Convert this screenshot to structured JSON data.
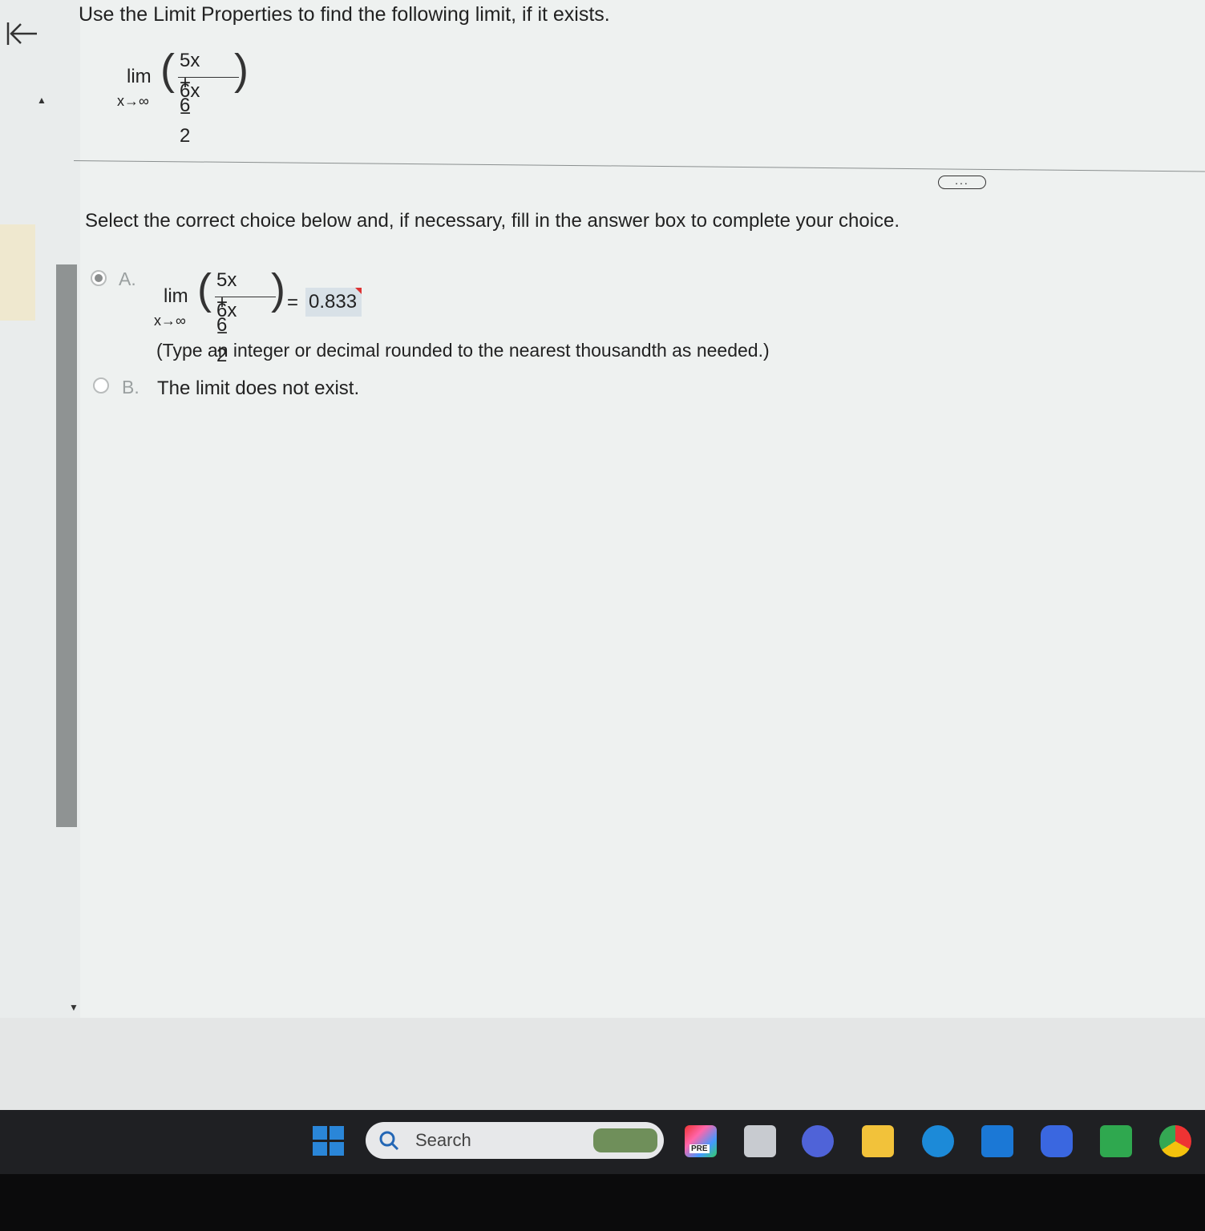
{
  "question": {
    "text": "Use the Limit Properties to find the following limit, if it exists.",
    "lim": "lim",
    "subscript": "x→∞",
    "numerator": "5x + 6",
    "denominator": "6x − 2"
  },
  "instruction": "Select the correct choice below and, if necessary, fill in the answer box to complete your choice.",
  "choice_a": {
    "letter": "A.",
    "lim": "lim",
    "subscript": "x→∞",
    "numerator": "5x + 6",
    "denominator": "6x − 2",
    "equals": "=",
    "answer": "0.833",
    "hint": "(Type an integer or decimal rounded to the nearest thousandth as needed.)",
    "selected": true
  },
  "choice_b": {
    "letter": "B.",
    "text": "The limit does not exist.",
    "selected": false
  },
  "more_button": "...",
  "taskbar": {
    "search_label": "Search",
    "pre_badge": "PRE",
    "icons": [
      "windows-start-icon",
      "search-icon",
      "app-pre-icon",
      "task-view-icon",
      "meet-icon",
      "file-explorer-icon",
      "edge-icon",
      "mail-icon",
      "copilot-icon",
      "store-icon",
      "chrome-icon"
    ]
  },
  "colors": {
    "accent": "#b0244a",
    "answer_bg": "#d8e1e7",
    "taskbar": "#1f2023"
  }
}
